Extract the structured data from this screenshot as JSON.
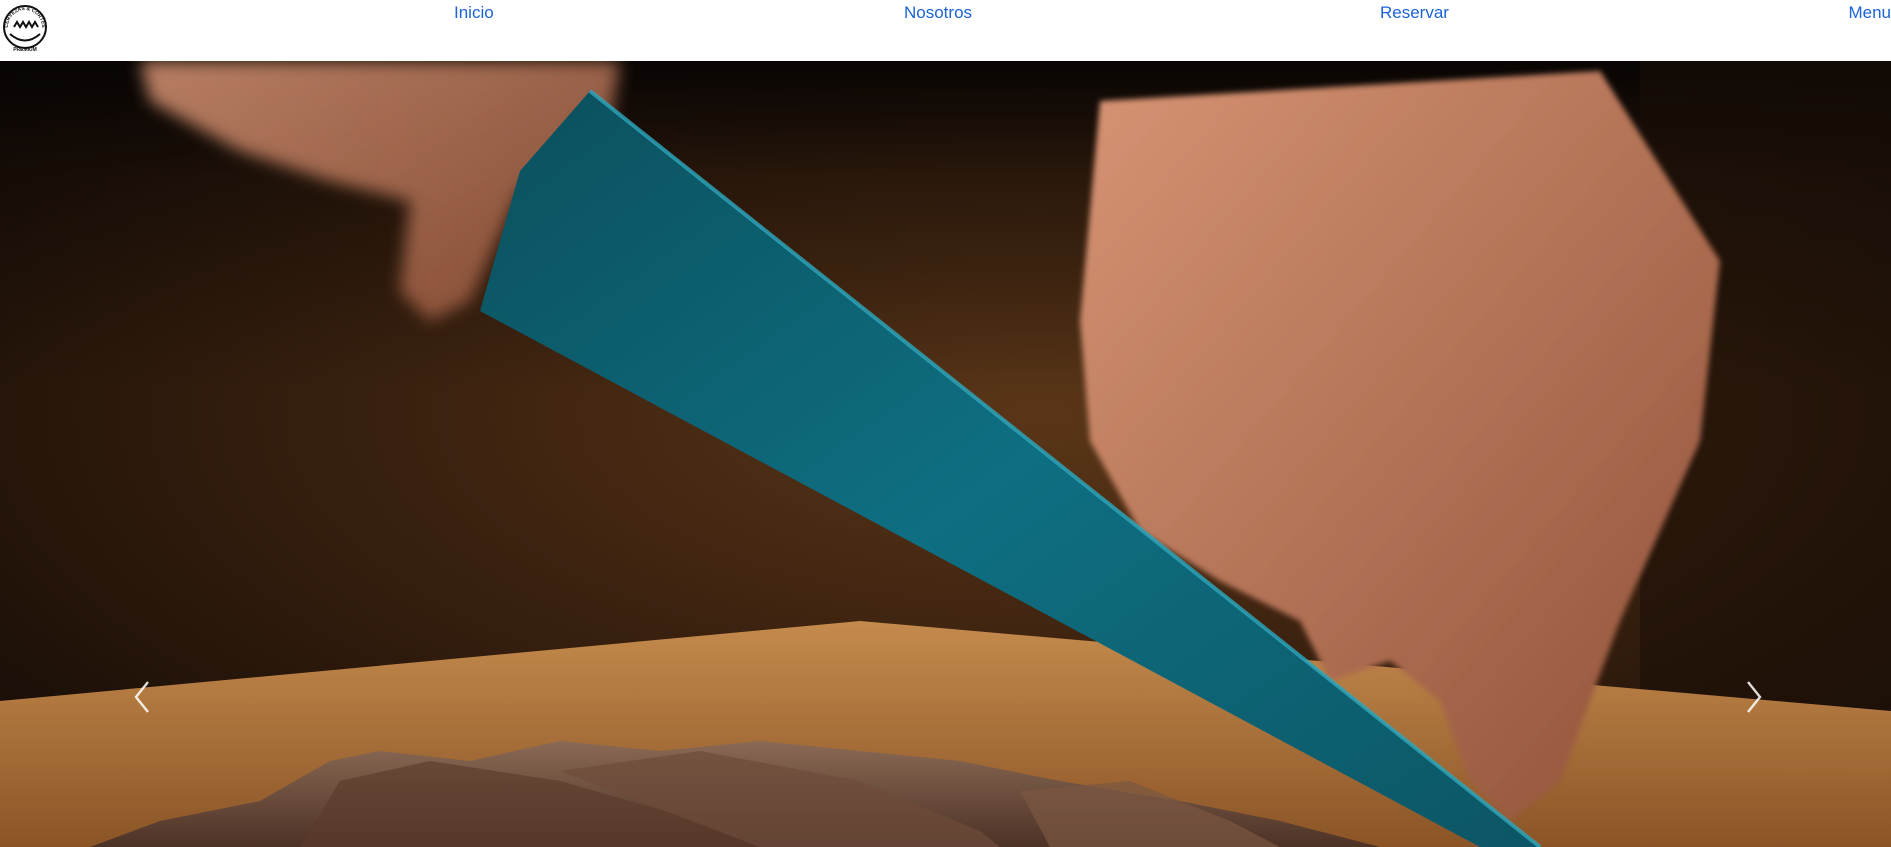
{
  "navbar": {
    "logo": {
      "icon": "brand-logo-icon",
      "text_top": "CERVEZAS & CORTES",
      "text_bottom": "PREMIUM"
    },
    "links": [
      {
        "label": "Inicio"
      },
      {
        "label": "Nosotros"
      },
      {
        "label": "Reservar"
      },
      {
        "label": "Menu"
      }
    ],
    "link_color": "#1a63d8"
  },
  "carousel": {
    "slide": {
      "image": "hero-photo-knife-slicing-steak",
      "accent_colors": {
        "knife_blade": "#0d6e80",
        "cutting_board": "#c98a45",
        "meat": "#6b4a38",
        "background": "#1b0f08"
      }
    },
    "controls": {
      "prev_icon": "chevron-left-icon",
      "next_icon": "chevron-right-icon"
    }
  }
}
